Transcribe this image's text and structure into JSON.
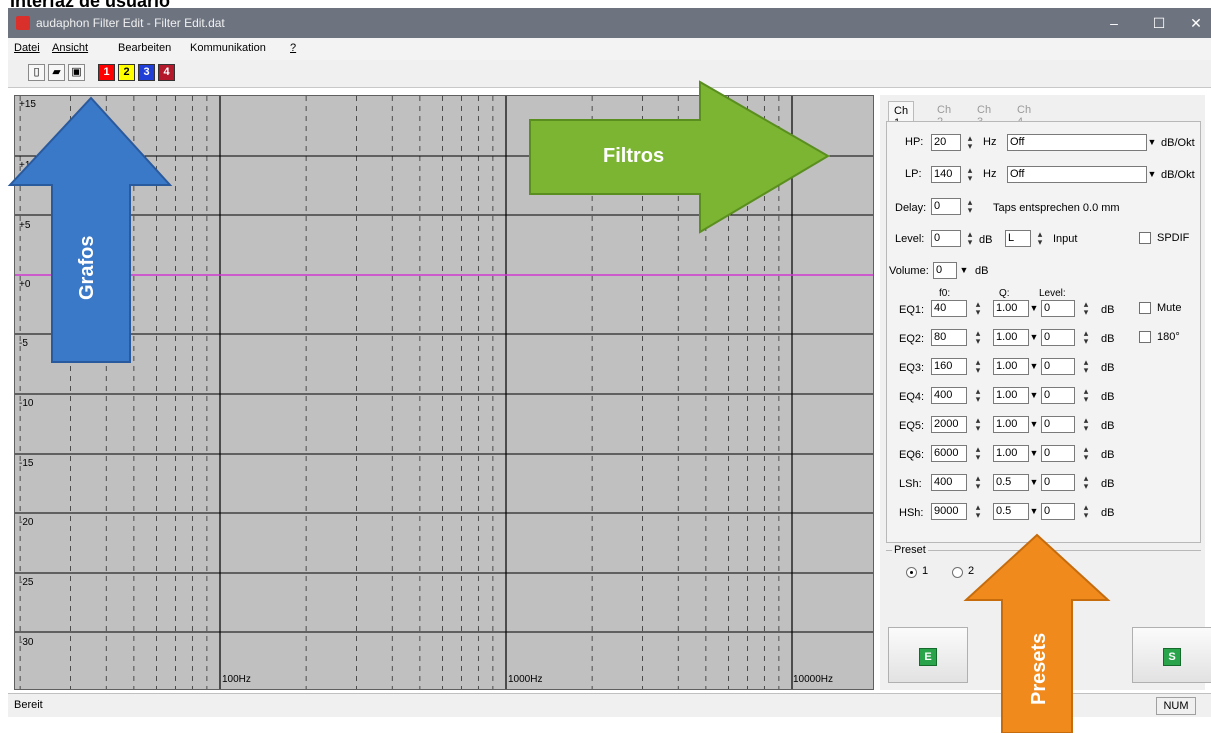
{
  "doc_heading": "Interfaz de usuario",
  "window": {
    "title": "audaphon Filter Edit - Filter Edit.dat",
    "minimize": "–",
    "maximize": "☐",
    "close": "✕"
  },
  "menu": [
    "Datei",
    "Ansicht",
    "Bearbeiten",
    "Kommunikation",
    "?"
  ],
  "toolbar": {
    "icons": [
      "new-file-icon",
      "open-folder-icon",
      "save-disk-icon"
    ],
    "channels": [
      {
        "label": "1",
        "color": "#ff0000",
        "text": "#ffffff"
      },
      {
        "label": "2",
        "color": "#ffff00",
        "text": "#000000"
      },
      {
        "label": "3",
        "color": "#1f3fd6",
        "text": "#ffffff"
      },
      {
        "label": "4",
        "color": "#b3192b",
        "text": "#ffffff"
      }
    ]
  },
  "graph": {
    "y_labels": [
      "+15",
      "+10",
      "+5",
      "+0",
      "-5",
      "-10",
      "-15",
      "-20",
      "-25",
      "-30"
    ],
    "x_labels": [
      "100Hz",
      "1000Hz",
      "10000Hz"
    ],
    "curve_color": "#d038d0",
    "grid_color": "#000000"
  },
  "panel": {
    "tabs": [
      "Ch 1",
      "Ch 2",
      "Ch 3",
      "Ch 4"
    ],
    "hp": {
      "label": "HP:",
      "value": "20",
      "unit": "Hz",
      "slope": "Off",
      "slope_unit": "dB/Okt"
    },
    "lp": {
      "label": "LP:",
      "value": "140",
      "unit": "Hz",
      "slope": "Off",
      "slope_unit": "dB/Okt"
    },
    "delay": {
      "label": "Delay:",
      "value": "0",
      "note": "Taps entsprechen 0.0 mm"
    },
    "level": {
      "label": "Level:",
      "value": "0",
      "unit": "dB",
      "input_value": "L",
      "input_label": "Input",
      "spdif": "SPDIF"
    },
    "volume": {
      "label": "Volume:",
      "value": "0",
      "unit": "dB"
    },
    "eq_headers": {
      "f0": "f0:",
      "q": "Q:",
      "level": "Level:"
    },
    "eq_rows": [
      {
        "label": "EQ1:",
        "f0": "40",
        "q": "1.00",
        "level": "0",
        "unit": "dB"
      },
      {
        "label": "EQ2:",
        "f0": "80",
        "q": "1.00",
        "level": "0",
        "unit": "dB"
      },
      {
        "label": "EQ3:",
        "f0": "160",
        "q": "1.00",
        "level": "0",
        "unit": "dB"
      },
      {
        "label": "EQ4:",
        "f0": "400",
        "q": "1.00",
        "level": "0",
        "unit": "dB"
      },
      {
        "label": "EQ5:",
        "f0": "2000",
        "q": "1.00",
        "level": "0",
        "unit": "dB"
      },
      {
        "label": "EQ6:",
        "f0": "6000",
        "q": "1.00",
        "level": "0",
        "unit": "dB"
      },
      {
        "label": "LSh:",
        "f0": "400",
        "q": "0.5",
        "level": "0",
        "unit": "dB"
      },
      {
        "label": "HSh:",
        "f0": "9000",
        "q": "0.5",
        "level": "0",
        "unit": "dB"
      }
    ],
    "mute": "Mute",
    "phase": "180°",
    "preset": {
      "title": "Preset",
      "options": [
        "1",
        "2"
      ],
      "selected": "1"
    },
    "btn_e": "E",
    "btn_s": "S"
  },
  "status": {
    "text": "Bereit",
    "num": "NUM"
  },
  "annotations": {
    "grafos": {
      "text": "Grafos",
      "color": "#3a78c8"
    },
    "filtros": {
      "text": "Filtros",
      "color": "#7cb531"
    },
    "presets": {
      "text": "Presets",
      "color": "#f08a1c"
    }
  }
}
